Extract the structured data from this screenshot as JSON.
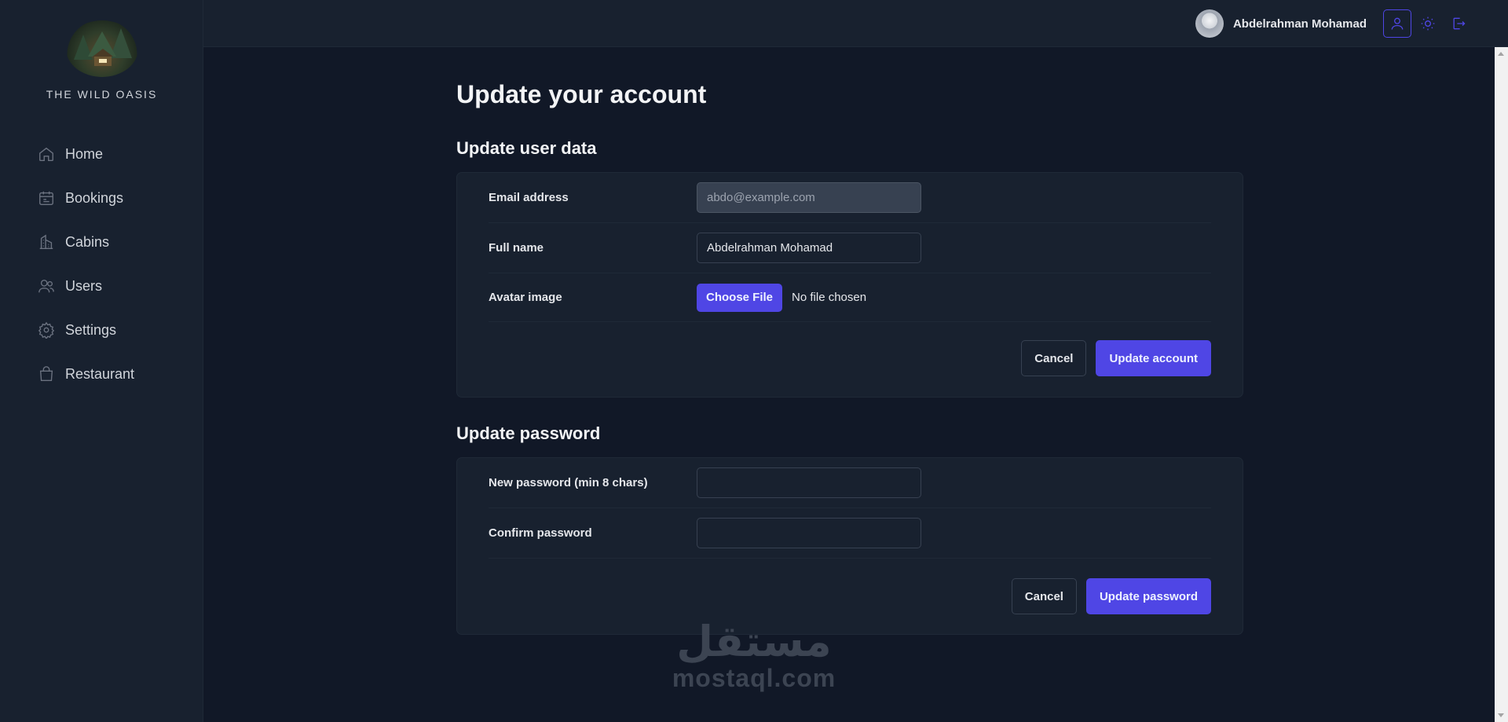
{
  "sidebar": {
    "brand": "THE WILD OASIS",
    "items": [
      {
        "label": "Home",
        "icon": "home-icon"
      },
      {
        "label": "Bookings",
        "icon": "calendar-icon"
      },
      {
        "label": "Cabins",
        "icon": "building-icon"
      },
      {
        "label": "Users",
        "icon": "users-icon"
      },
      {
        "label": "Settings",
        "icon": "gear-icon"
      },
      {
        "label": "Restaurant",
        "icon": "shopping-bag-icon"
      }
    ]
  },
  "header": {
    "user_name": "Abdelrahman Mohamad",
    "buttons": [
      "user-icon",
      "sun-icon",
      "logout-icon"
    ]
  },
  "main": {
    "title": "Update your account",
    "user_section": {
      "title": "Update user data",
      "email_label": "Email address",
      "email_value": "abdo@example.com",
      "fullname_label": "Full name",
      "fullname_value": "Abdelrahman Mohamad",
      "avatar_label": "Avatar image",
      "file_button": "Choose File",
      "file_status": "No file chosen",
      "cancel": "Cancel",
      "submit": "Update account"
    },
    "password_section": {
      "title": "Update password",
      "new_label": "New password (min 8 chars)",
      "new_value": "",
      "confirm_label": "Confirm password",
      "confirm_value": "",
      "cancel": "Cancel",
      "submit": "Update password"
    }
  },
  "watermark": {
    "arabic": "مستقل",
    "latin": "mostaql.com"
  },
  "colors": {
    "accent": "#4f46e5",
    "background": "#111827",
    "panel": "#18212f",
    "border": "#1f2937"
  }
}
